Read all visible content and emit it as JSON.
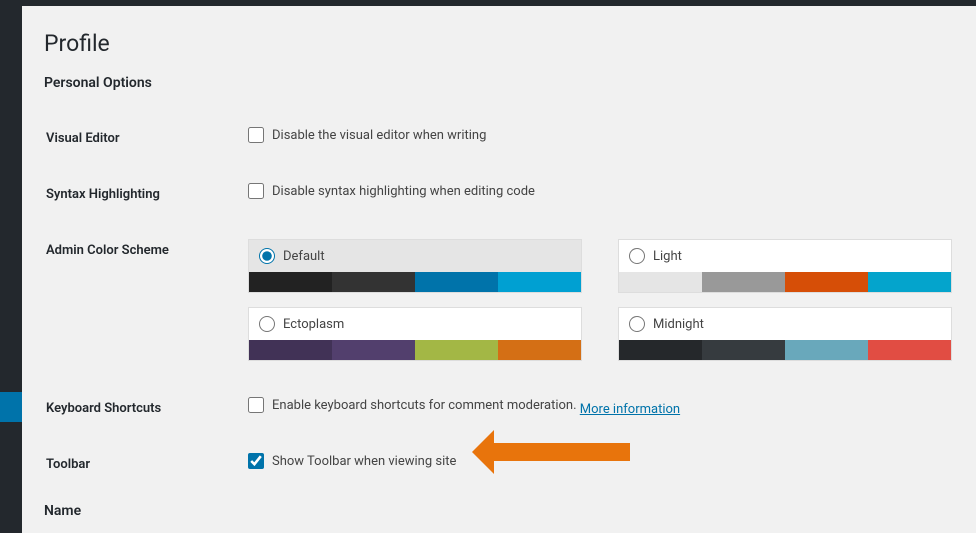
{
  "page": {
    "title": "Profile"
  },
  "sections": {
    "personal": "Personal Options",
    "name": "Name"
  },
  "rows": {
    "visual_editor": {
      "label": "Visual Editor",
      "checkbox_label": "Disable the visual editor when writing",
      "checked": false
    },
    "syntax_highlighting": {
      "label": "Syntax Highlighting",
      "checkbox_label": "Disable syntax highlighting when editing code",
      "checked": false
    },
    "admin_color_scheme": {
      "label": "Admin Color Scheme"
    },
    "keyboard_shortcuts": {
      "label": "Keyboard Shortcuts",
      "checkbox_label": "Enable keyboard shortcuts for comment moderation.",
      "link_text": "More information",
      "checked": false
    },
    "toolbar": {
      "label": "Toolbar",
      "checkbox_label": "Show Toolbar when viewing site",
      "checked": true
    }
  },
  "color_schemes": [
    {
      "name": "Default",
      "selected": true,
      "colors": [
        "#222222",
        "#333333",
        "#0073aa",
        "#00a0d2"
      ]
    },
    {
      "name": "Light",
      "selected": false,
      "colors": [
        "#e5e5e5",
        "#999999",
        "#d64e07",
        "#04a4cc"
      ]
    },
    {
      "name": "Ectoplasm",
      "selected": false,
      "colors": [
        "#413256",
        "#523f6d",
        "#a3b745",
        "#d46f15"
      ]
    },
    {
      "name": "Midnight",
      "selected": false,
      "colors": [
        "#25282b",
        "#363b3f",
        "#69a8bb",
        "#e14d43"
      ]
    }
  ]
}
